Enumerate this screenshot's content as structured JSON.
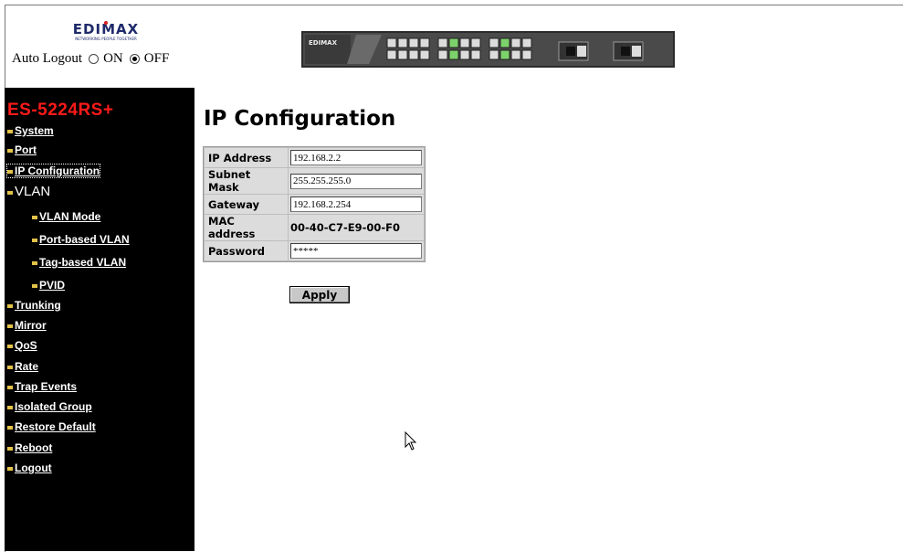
{
  "header": {
    "brand": "EDIMAX",
    "brand_tagline": "NETWORKING PEOPLE TOGETHER",
    "auto_logout_label": "Auto Logout",
    "auto_logout_on": "ON",
    "auto_logout_off": "OFF",
    "auto_logout_selected": "OFF",
    "switch_image": {
      "brand": "EDIMAX"
    }
  },
  "sidebar": {
    "model": "ES-5224RS+",
    "items": [
      {
        "label": "System"
      },
      {
        "label": "Port"
      },
      {
        "label": "IP Configuration",
        "current": true
      },
      {
        "label": "VLAN"
      },
      {
        "label": "VLAN Mode"
      },
      {
        "label": "Port-based VLAN"
      },
      {
        "label": "Tag-based VLAN"
      },
      {
        "label": "PVID"
      },
      {
        "label": "Trunking"
      },
      {
        "label": "Mirror"
      },
      {
        "label": "QoS"
      },
      {
        "label": "Rate"
      },
      {
        "label": "Trap Events"
      },
      {
        "label": "Isolated Group"
      },
      {
        "label": "Restore Default"
      },
      {
        "label": "Reboot"
      },
      {
        "label": "Logout"
      }
    ]
  },
  "main": {
    "title": "IP Configuration",
    "fields": {
      "ip_address": {
        "label": "IP Address",
        "value": "192.168.2.2"
      },
      "subnet_mask": {
        "label": "Subnet Mask",
        "value": "255.255.255.0"
      },
      "gateway": {
        "label": "Gateway",
        "value": "192.168.2.254"
      },
      "mac_address": {
        "label": "MAC address",
        "value": "00-40-C7-E9-00-F0"
      },
      "password": {
        "label": "Password",
        "value": "*****"
      }
    },
    "apply_label": "Apply"
  },
  "colors": {
    "sidebar_bg": "#000000",
    "model_text": "#ff1a1a",
    "nav_text": "#ffffff",
    "bullet": "#e3c24a",
    "table_label_bg": "#dcdcdc"
  }
}
